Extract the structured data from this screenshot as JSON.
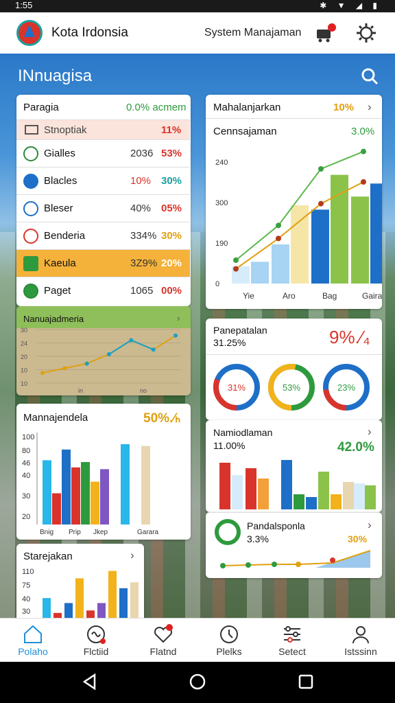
{
  "status": {
    "time": "1:55",
    "icons": "✱ ▼ ◢ ▮"
  },
  "header": {
    "app_title": "Kota Irdonsia",
    "system_label": "System Manajaman"
  },
  "heading": "INnuagisa",
  "panel_a": {
    "title": "Paragia",
    "title_value": "0.0% acmem",
    "rows": [
      {
        "name": "Stnoptiak",
        "v1": "",
        "v2": "11%",
        "icon": "tablet-icon"
      },
      {
        "name": "Gialles",
        "v1": "2036",
        "v2": "53%",
        "icon": "leaf-icon"
      },
      {
        "name": "Blacles",
        "v1": "10%",
        "v2": "30%",
        "icon": "globe-icon"
      },
      {
        "name": "Bleser",
        "v1": "40%",
        "v2": "05%",
        "icon": "grid-globe-icon"
      },
      {
        "name": "Benderia",
        "v1": "334%",
        "v2": "30%",
        "icon": "chart-circle-icon"
      },
      {
        "name": "Kaeula",
        "v1": "3Z9%",
        "v2": "20%",
        "icon": "plant-icon"
      },
      {
        "name": "Paget",
        "v1": "1065",
        "v2": "00%",
        "icon": "sprout-icon"
      }
    ]
  },
  "panel_b": {
    "title": "Nanuajadmeria"
  },
  "panel_c": {
    "title": "Mahalanjarkan",
    "title_value": "10%",
    "subtitle": "Cennsajaman",
    "sub_value": "3.0%"
  },
  "panel_d": {
    "title": "Panepatalan",
    "subtitle": "31.25%",
    "big_value": "9%.⁄₄",
    "donuts": [
      {
        "label": "31%",
        "color": "#1e6fc7",
        "accent": "#d9342b"
      },
      {
        "label": "53%",
        "color": "#2e9a3e",
        "accent": "#f2b21b"
      },
      {
        "label": "23%",
        "color": "#1e6fc7",
        "accent": "#d9342b"
      }
    ]
  },
  "panel_e": {
    "title": "Namiodlaman",
    "subtitle": "11.00%",
    "value": "42.0%"
  },
  "panel_f": {
    "title": "Pandalsponla",
    "subtitle": "3.3%",
    "value": "30%"
  },
  "panel_g": {
    "title": "Mannajendela",
    "value": "50%.⁄ₕ"
  },
  "panel_h": {
    "title": "Starejakan"
  },
  "nav": [
    {
      "label": "Polaho",
      "icon": "home-icon",
      "active": true
    },
    {
      "label": "Flctiid",
      "icon": "scribble-icon",
      "active": false
    },
    {
      "label": "Flatnd",
      "icon": "heart-icon",
      "active": false
    },
    {
      "label": "Plelks",
      "icon": "clock-icon",
      "active": false
    },
    {
      "label": "Setect",
      "icon": "sliders-icon",
      "active": false
    },
    {
      "label": "Istssinn",
      "icon": "user-icon",
      "active": false
    }
  ],
  "colors": {
    "accent_blue": "#1e6fc7",
    "red": "#d9342b",
    "green": "#2e9a3e",
    "orange": "#f2b21b"
  },
  "chart_data": [
    {
      "type": "line",
      "title": "Nanuajadmeria",
      "y_ticks": [
        "30",
        "24",
        "20",
        "10",
        "10"
      ],
      "x_labels": [
        "in",
        "no"
      ],
      "series": [
        {
          "values": [
            1,
            2,
            3,
            5,
            8,
            6,
            9
          ]
        }
      ]
    },
    {
      "type": "bar",
      "title": "Mahalanjarkan",
      "y_ticks": [
        "240",
        "300",
        "190",
        "0"
      ],
      "categories": [
        "Yie",
        "Aro",
        "Bag",
        "Gairat"
      ],
      "series": [
        {
          "values": [
            50,
            180,
            250,
            230
          ]
        },
        {
          "values": [
            40,
            90,
            170,
            200
          ]
        }
      ],
      "lines": [
        {
          "values": [
            30,
            110,
            240,
            280
          ]
        },
        {
          "values": [
            10,
            80,
            160,
            210
          ]
        }
      ]
    },
    {
      "type": "bar",
      "title": "Mannajendela",
      "y_ticks": [
        "100",
        "80",
        "46",
        "40",
        "30",
        "20"
      ],
      "categories": [
        "Bnig",
        "Prip",
        "Jkep",
        "Garara"
      ],
      "values": [
        72,
        35,
        84,
        64,
        70,
        48,
        62,
        90,
        88
      ]
    },
    {
      "type": "bar",
      "title": "Starejakan",
      "y_ticks": [
        "110",
        "75",
        "40",
        "30"
      ],
      "values": [
        40,
        10,
        30,
        80,
        15,
        30,
        95,
        60,
        72
      ]
    }
  ]
}
